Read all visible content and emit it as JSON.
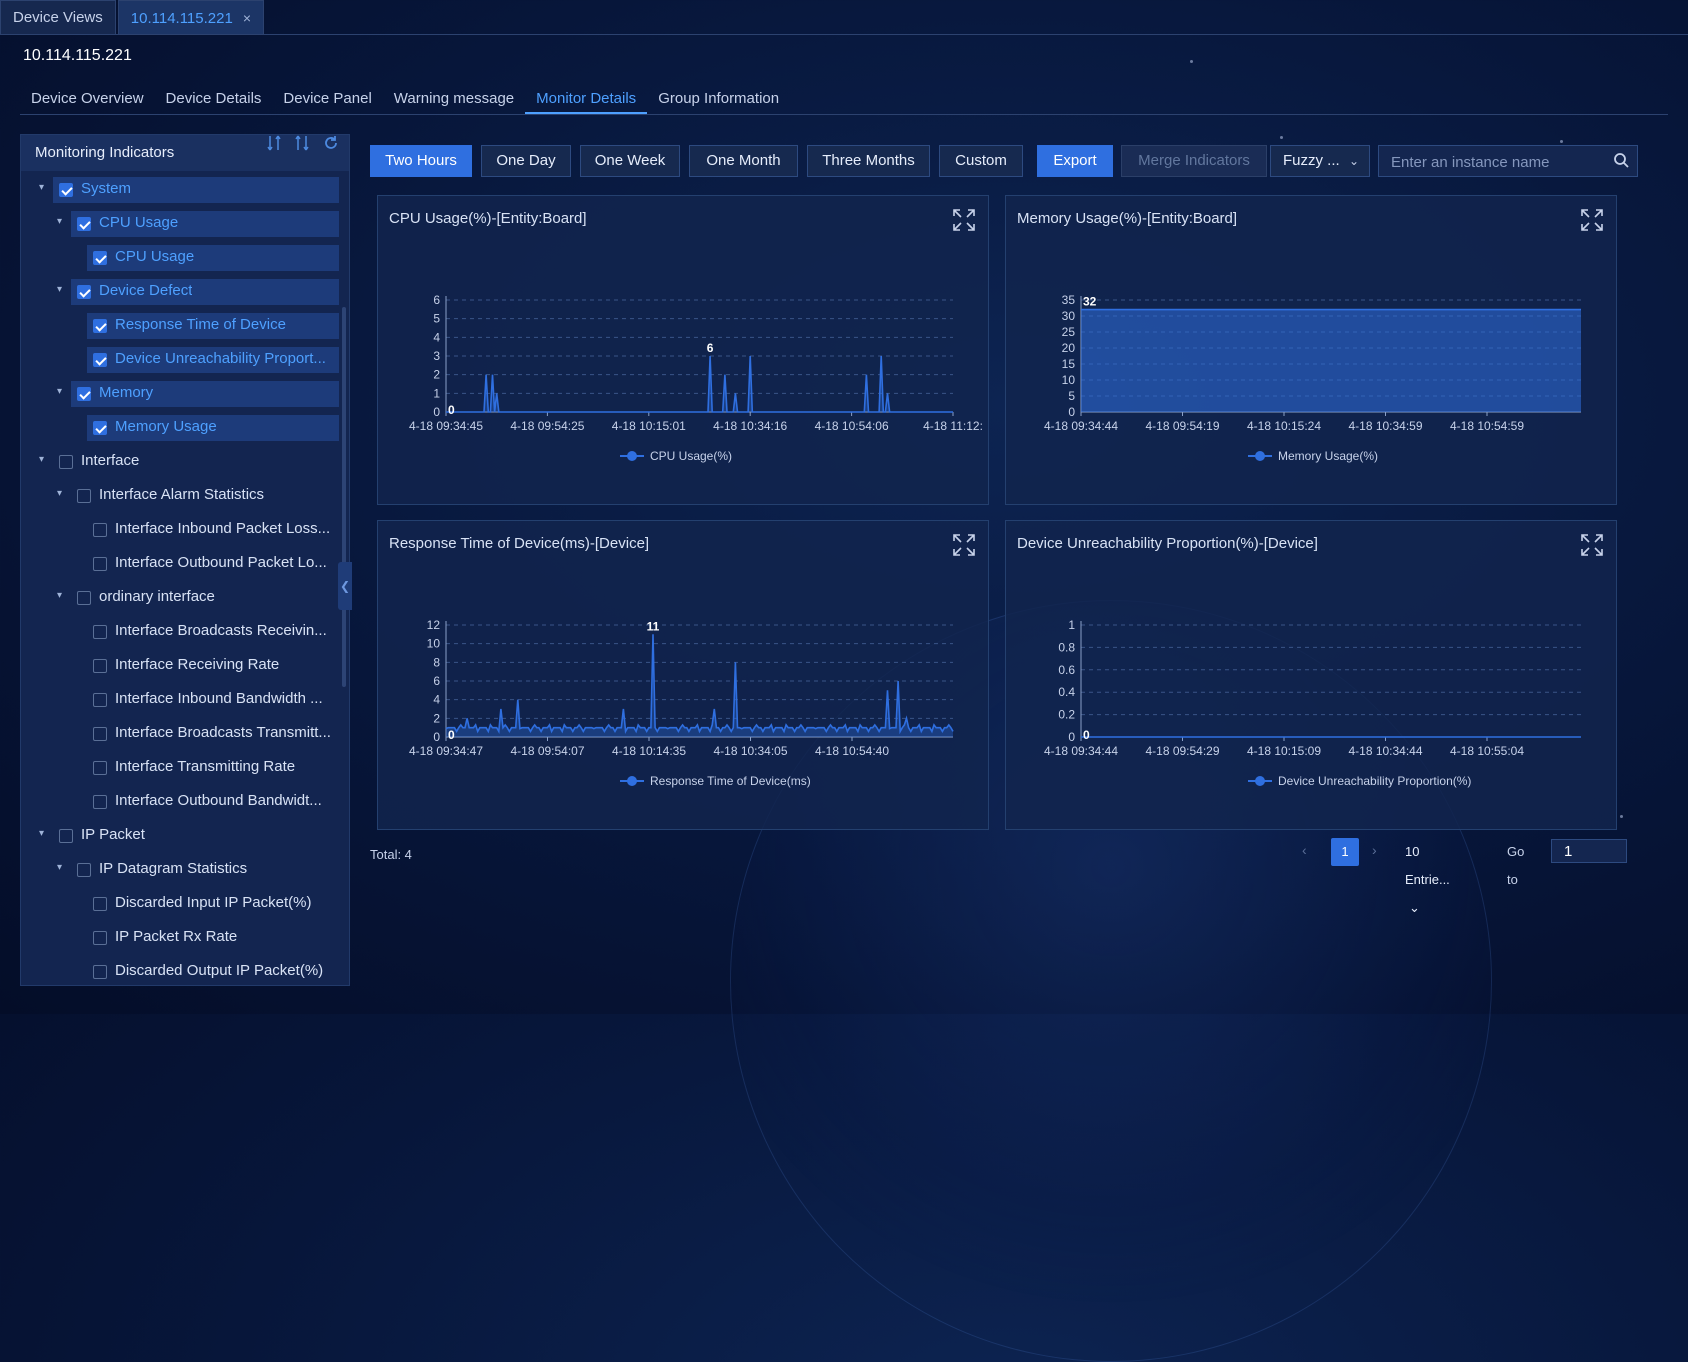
{
  "tabs": [
    {
      "label": "Device Views",
      "active": false
    },
    {
      "label": "10.114.115.221",
      "active": true,
      "close": "×"
    }
  ],
  "device_ip": "10.114.115.221",
  "nav": [
    "Device Overview",
    "Device Details",
    "Device Panel",
    "Warning message",
    "Monitor Details",
    "Group Information"
  ],
  "nav_active": "Monitor Details",
  "sidebar": {
    "title": "Monitoring Indicators",
    "header_icons": [
      "collapse-all-icon",
      "expand-all-icon",
      "refresh-icon"
    ],
    "tree": [
      {
        "label": "System",
        "level": 0,
        "checked": true,
        "caret": true
      },
      {
        "label": "CPU Usage",
        "level": 1,
        "checked": true,
        "caret": true
      },
      {
        "label": "CPU Usage",
        "level": 2,
        "checked": true,
        "caret": false
      },
      {
        "label": "Device Defect",
        "level": 1,
        "checked": true,
        "caret": true
      },
      {
        "label": "Response Time of Device",
        "level": 2,
        "checked": true,
        "caret": false
      },
      {
        "label": "Device Unreachability Proport...",
        "level": 2,
        "checked": true,
        "caret": false
      },
      {
        "label": "Memory",
        "level": 1,
        "checked": true,
        "caret": true
      },
      {
        "label": "Memory Usage",
        "level": 2,
        "checked": true,
        "caret": false
      },
      {
        "label": "Interface",
        "level": 0,
        "checked": false,
        "caret": true
      },
      {
        "label": "Interface Alarm Statistics",
        "level": 1,
        "checked": false,
        "caret": true
      },
      {
        "label": "Interface Inbound Packet Loss...",
        "level": 2,
        "checked": false,
        "caret": false
      },
      {
        "label": "Interface Outbound Packet Lo...",
        "level": 2,
        "checked": false,
        "caret": false
      },
      {
        "label": "ordinary interface",
        "level": 1,
        "checked": false,
        "caret": true
      },
      {
        "label": "Interface Broadcasts Receivin...",
        "level": 2,
        "checked": false,
        "caret": false
      },
      {
        "label": "Interface Receiving Rate",
        "level": 2,
        "checked": false,
        "caret": false
      },
      {
        "label": "Interface Inbound Bandwidth ...",
        "level": 2,
        "checked": false,
        "caret": false
      },
      {
        "label": "Interface Broadcasts Transmitt...",
        "level": 2,
        "checked": false,
        "caret": false
      },
      {
        "label": "Interface Transmitting Rate",
        "level": 2,
        "checked": false,
        "caret": false
      },
      {
        "label": "Interface Outbound Bandwidt...",
        "level": 2,
        "checked": false,
        "caret": false
      },
      {
        "label": "IP Packet",
        "level": 0,
        "checked": false,
        "caret": true
      },
      {
        "label": "IP Datagram Statistics",
        "level": 1,
        "checked": false,
        "caret": true
      },
      {
        "label": "Discarded Input IP Packet(%)",
        "level": 2,
        "checked": false,
        "caret": false
      },
      {
        "label": "IP Packet Rx Rate",
        "level": 2,
        "checked": false,
        "caret": false
      },
      {
        "label": "Discarded Output IP Packet(%)",
        "level": 2,
        "checked": false,
        "caret": false
      }
    ]
  },
  "toolbar": {
    "time_buttons": [
      "Two Hours",
      "One Day",
      "One Week",
      "One Month",
      "Three Months",
      "Custom"
    ],
    "active_time": "Two Hours",
    "export": "Export",
    "merge": "Merge Indicators",
    "match_mode": "Fuzzy ...",
    "search_placeholder": "Enter an instance name"
  },
  "colors": {
    "accent": "#2f6fe0",
    "series": "#2f6fe0",
    "link": "#4ea0ff"
  },
  "chart_data": [
    {
      "type": "line",
      "title": "CPU Usage(%)-[Entity:Board]",
      "series": [
        {
          "name": "CPU Usage(%)",
          "peaks": [
            [
              0.08,
              2
            ],
            [
              0.09,
              2
            ],
            [
              0.1,
              1
            ],
            [
              0.52,
              3
            ],
            [
              0.55,
              2
            ],
            [
              0.57,
              1
            ],
            [
              0.6,
              3
            ],
            [
              0.83,
              2
            ],
            [
              0.86,
              3
            ],
            [
              0.87,
              1
            ]
          ]
        }
      ],
      "x_ticks": [
        "4-18 09:34:45",
        "4-18 09:54:25",
        "4-18 10:15:01",
        "4-18 10:34:16",
        "4-18 10:54:06",
        "4-18 11:12:"
      ],
      "y_ticks": [
        0,
        1,
        2,
        3,
        4,
        5,
        6
      ],
      "ylim": [
        0,
        6
      ],
      "max_label": "6",
      "min_label": "0",
      "grid": true,
      "legend": "bottom"
    },
    {
      "type": "area",
      "title": "Memory Usage(%)-[Entity:Board]",
      "series": [
        {
          "name": "Memory Usage(%)",
          "constant": 32
        }
      ],
      "x_ticks": [
        "4-18 09:34:44",
        "4-18 09:54:19",
        "4-18 10:15:24",
        "4-18 10:34:59",
        "4-18 10:54:59"
      ],
      "y_ticks": [
        0,
        5,
        10,
        15,
        20,
        25,
        30,
        35
      ],
      "ylim": [
        0,
        35
      ],
      "max_label": "32",
      "grid": true,
      "legend": "bottom"
    },
    {
      "type": "line",
      "title": "Response Time of Device(ms)-[Device]",
      "series": [
        {
          "name": "Response Time of Device(ms)",
          "baseline": 1,
          "peaks": [
            [
              0.04,
              2
            ],
            [
              0.11,
              3
            ],
            [
              0.14,
              4
            ],
            [
              0.35,
              3
            ],
            [
              0.41,
              11
            ],
            [
              0.53,
              3
            ],
            [
              0.57,
              8
            ],
            [
              0.87,
              5
            ],
            [
              0.89,
              6
            ],
            [
              0.91,
              2
            ]
          ]
        }
      ],
      "x_ticks": [
        "4-18 09:34:47",
        "4-18 09:54:07",
        "4-18 10:14:35",
        "4-18 10:34:05",
        "4-18 10:54:40"
      ],
      "y_ticks": [
        0,
        2,
        4,
        6,
        8,
        10,
        12
      ],
      "ylim": [
        0,
        12
      ],
      "max_label": "11",
      "min_label": "0",
      "grid": true,
      "legend": "bottom"
    },
    {
      "type": "line",
      "title": "Device Unreachability Proportion(%)-[Device]",
      "series": [
        {
          "name": "Device Unreachability Proportion(%)",
          "constant": 0
        }
      ],
      "x_ticks": [
        "4-18 09:34:44",
        "4-18 09:54:29",
        "4-18 10:15:09",
        "4-18 10:34:44",
        "4-18 10:55:04"
      ],
      "y_ticks": [
        0,
        0.2,
        0.4,
        0.6,
        0.8,
        1
      ],
      "ylim": [
        0,
        1
      ],
      "min_label": "0",
      "grid": true,
      "legend": "bottom"
    }
  ],
  "footer": {
    "total": "Total: 4",
    "page": "1",
    "page_size": "10 Entrie...",
    "goto_label": "Go to",
    "goto_value": "1"
  }
}
